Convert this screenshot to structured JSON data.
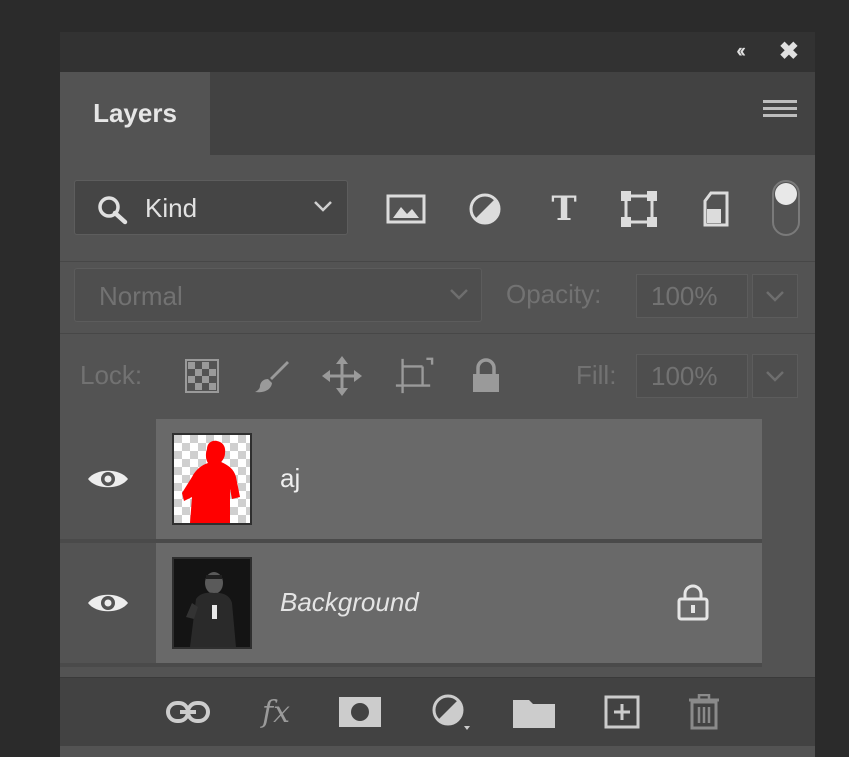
{
  "panel": {
    "title_bar": {
      "collapse_glyph": "‹‹",
      "close_glyph": "✖"
    },
    "tab": {
      "label": "Layers"
    },
    "menu_icon": "hamburger-menu-icon"
  },
  "filter": {
    "kind_label": "Kind",
    "icons": [
      "image-filter-icon",
      "adjustment-filter-icon",
      "type-filter-icon",
      "shape-filter-icon",
      "smart-object-filter-icon"
    ],
    "type_glyph": "T"
  },
  "blend": {
    "mode": "Normal",
    "opacity_label": "Opacity:",
    "opacity_value": "100%"
  },
  "lock": {
    "label": "Lock:",
    "icons": [
      "lock-transparent-pixels-icon",
      "lock-image-pixels-icon",
      "lock-position-icon",
      "lock-artboard-icon",
      "lock-all-icon"
    ],
    "fill_label": "Fill:",
    "fill_value": "100%"
  },
  "layers": [
    {
      "name": "aj",
      "visible": true,
      "locked": false,
      "italic": false,
      "thumb": "red-silhouette-on-transparent"
    },
    {
      "name": "Background",
      "visible": true,
      "locked": true,
      "italic": true,
      "thumb": "photo-of-man-dark"
    }
  ],
  "bottom_bar": {
    "fx_label": "fx",
    "icons": [
      "link-layers-icon",
      "layer-style-fx-icon",
      "add-mask-icon",
      "new-adjustment-layer-icon",
      "new-group-folder-icon",
      "new-layer-icon",
      "delete-layer-trash-icon"
    ]
  },
  "colors": {
    "panel_bg": "#535353",
    "selected_layer_bg": "#696969",
    "silhouette_red": "#ff0000"
  }
}
